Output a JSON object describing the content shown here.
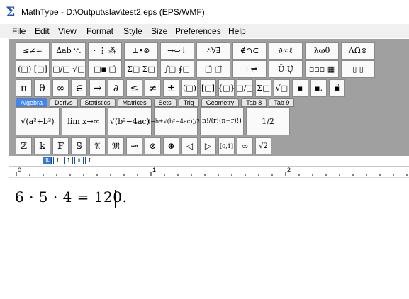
{
  "window": {
    "title": "MathType - D:\\Output\\slav\\test2.eps (EPS/WMF)",
    "app_icon_glyph": "Σ"
  },
  "menu": [
    "File",
    "Edit",
    "View",
    "Format",
    "Style",
    "Size",
    "Preferences",
    "Help"
  ],
  "toolbar": {
    "row1": [
      "≤≠≈",
      "∆ab ∵.",
      "⋅ ⋮ ⁂",
      "±•⊗",
      "→⇔↓",
      "∴∀∃",
      "∉∩⊂",
      "∂∞ℓ",
      "λωθ",
      "ΛΩ⊛"
    ],
    "row2": [
      "(□) [□]",
      "□/□ √□",
      "□▪ □̇",
      "Σ□ Σ□",
      "∫□ ∮□",
      "□̄ □⃗",
      "→ ⇌",
      "Ū Ụ̇",
      "▫▫▫ ▦",
      "▯ ▯"
    ],
    "row3": [
      "π",
      "θ",
      "∞",
      "∈",
      "→",
      "∂",
      "≤",
      "≠",
      "±",
      "(□)",
      "[□]",
      "{□}",
      "□/□",
      "Σ□",
      "√□",
      "▪̇",
      "▪.",
      "▪̈"
    ],
    "tabs": [
      "Algebra",
      "Derivs",
      "Statistics",
      "Matrices",
      "Sets",
      "Trig",
      "Geometry",
      "Tab 8",
      "Tab 9"
    ],
    "active_tab": "Algebra",
    "templates": [
      "√(a²+b²)",
      "lim x→∞",
      "√(b²−4ac)",
      "(−b±√(b²−4ac))/2a",
      "n!/(r!(n−r)!)",
      "1/2"
    ],
    "symbols": [
      "ℤ",
      "𝕜",
      "𝔽",
      "𝕊",
      "𝔄",
      "𝔐",
      "⊸",
      "⊗",
      "⊕",
      "◁",
      "▷",
      "[0,1]",
      "∞",
      "√2"
    ]
  },
  "nudge_buttons": [
    "⇅",
    "↑",
    "⇡",
    "⇑",
    "↥"
  ],
  "ruler": {
    "marks": [
      "0",
      "1",
      "2"
    ]
  },
  "document": {
    "equation": "6 · 5 · 4 = 120."
  },
  "colors": {
    "toolbar_bg": "#a0a0a0",
    "active_tab": "#3a86ff",
    "app_icon": "#1f55b0"
  }
}
